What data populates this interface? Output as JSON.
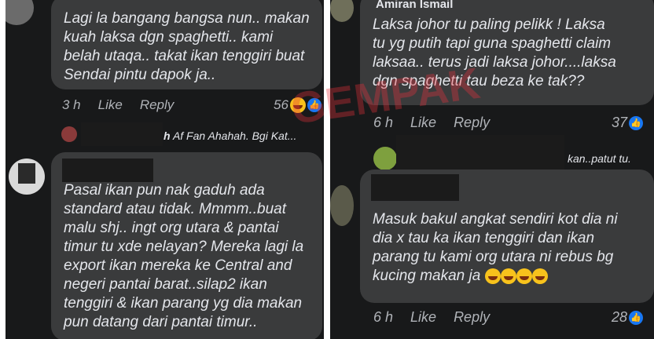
{
  "left": {
    "comment1": {
      "lines": [
        "Lagi la bangang bangsa nun.. makan",
        "kuah laksa dgn spaghetti.. kami",
        "belah utaqa.. takat ikan tenggiri buat",
        "Sendai pintu dapok ja.."
      ],
      "time": "3 h",
      "like_label": "Like",
      "reply_label": "Reply",
      "reactions": "56"
    },
    "reply_snippet": {
      "prefix": "h",
      "text": "Af Fan Ahahah. Bgi Kat..."
    },
    "comment2": {
      "lines": [
        "Pasal ikan pun nak gaduh ada",
        "standard atau tidak. Mmmm..buat",
        "malu shj.. ingt org utara & pantai",
        "timur tu xde nelayan? Mereka lagi la",
        "export ikan mereka ke Central and",
        "negeri pantai barat..silap2 ikan",
        "tenggiri & ikan parang yg dia makan",
        "pun datang dari pantai timur.."
      ]
    }
  },
  "right": {
    "header_name": "Amiran Ismail",
    "comment1": {
      "lines": [
        "Laksa johor tu paling pelikk ! Laksa",
        "tu yg putih tapi guna spaghetti claim",
        "laksaa.. terus jadi laksa johor....laksa",
        "dgn spaghetti tau beza ke tak??"
      ],
      "time": "6 h",
      "like_label": "Like",
      "reply_label": "Reply",
      "reactions": "37"
    },
    "reply_snippet": {
      "text": "kan..patut tu."
    },
    "comment2": {
      "lines": [
        "Masuk bakul angkat sendiri kot dia ni",
        "dia x tau ka ikan tenggiri dan ikan",
        "parang tu kami org utara ni rebus bg",
        "kucing makan ja"
      ],
      "time": "6 h",
      "like_label": "Like",
      "reply_label": "Reply",
      "reactions": "28"
    }
  },
  "watermark": "GEMPAK",
  "colors": {
    "background": "#18191a",
    "bubble": "#3a3b3c",
    "text": "#e4e6eb",
    "meta": "#b0b3b8",
    "like_blue": "#1877f2",
    "watermark_red": "#e8323c"
  },
  "icons": [
    "laughing-emoji-icon",
    "like-badge-icon"
  ]
}
